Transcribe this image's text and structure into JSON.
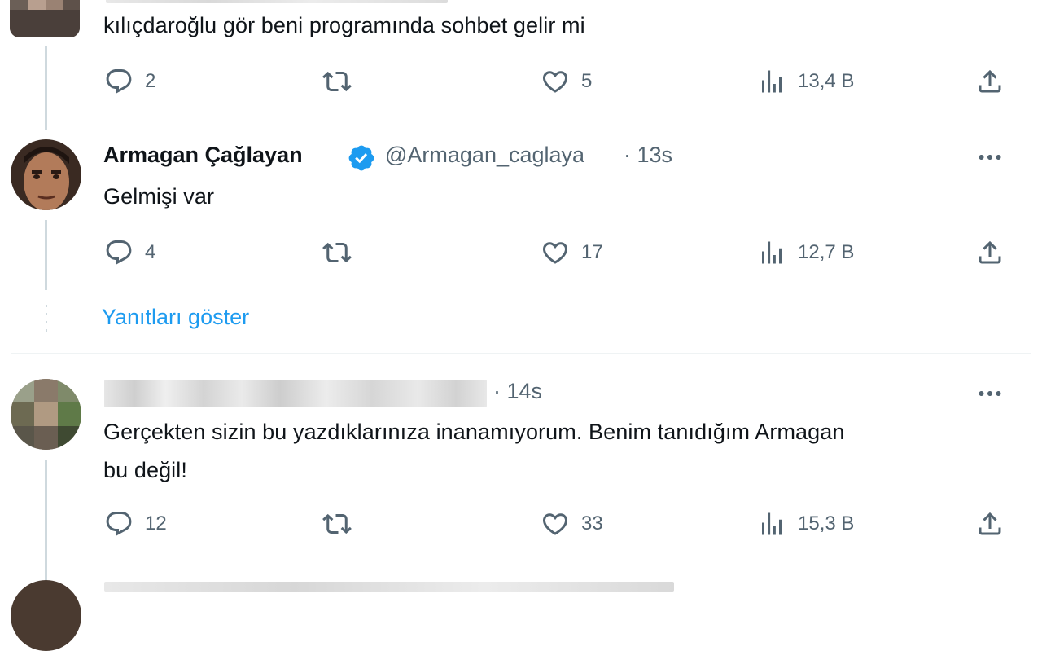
{
  "tweets": [
    {
      "text": "kılıçdaroğlu gör beni programında sohbet gelir mi",
      "stats": {
        "replies": "2",
        "likes": "5",
        "views": "13,4 B"
      }
    },
    {
      "author": "Armagan Çağlayan",
      "handle": "@Armagan_caglaya",
      "time": "· 13s",
      "text": "Gelmişi var",
      "stats": {
        "replies": "4",
        "likes": "17",
        "views": "12,7 B"
      },
      "show_replies": "Yanıtları göster"
    },
    {
      "time": "· 14s",
      "text_line1": "Gerçekten sizin bu yazdıklarınıza inanamıyorum. Benim tanıdığım Armagan",
      "text_line2": "bu değil!",
      "stats": {
        "replies": "12",
        "likes": "33",
        "views": "15,3 B"
      }
    }
  ],
  "colors": {
    "accent": "#1d9bf0",
    "muted": "#536471",
    "text": "#0f1419",
    "line": "#cfd9de"
  },
  "icons": [
    "reply-icon",
    "retweet-icon",
    "like-icon",
    "views-icon",
    "share-icon",
    "verified-icon",
    "more-icon"
  ]
}
